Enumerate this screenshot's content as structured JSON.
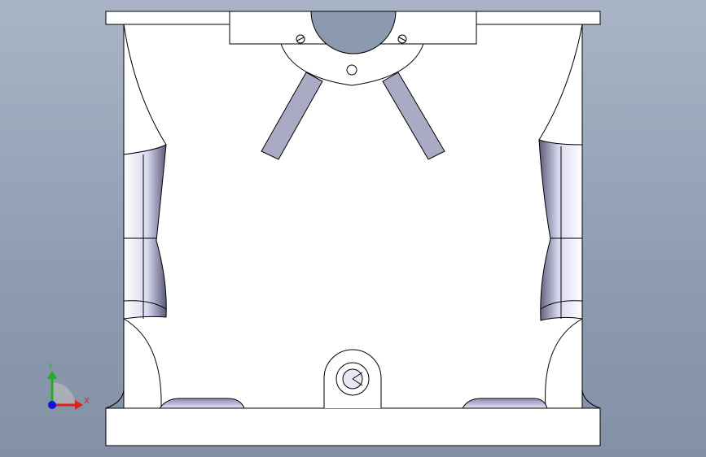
{
  "viewport": {
    "background_top": "#a9b5c6",
    "background_bottom": "#8391a6"
  },
  "part": {
    "fill": "#ffffff",
    "edge_color": "#000000",
    "insert_color": "#aaaac5",
    "cavity_color": "#c8c8e6"
  },
  "triad": {
    "x_label": "X",
    "y_label": "Y",
    "x_color": "#e02020",
    "y_color": "#20b020",
    "z_color": "#1010e0"
  }
}
